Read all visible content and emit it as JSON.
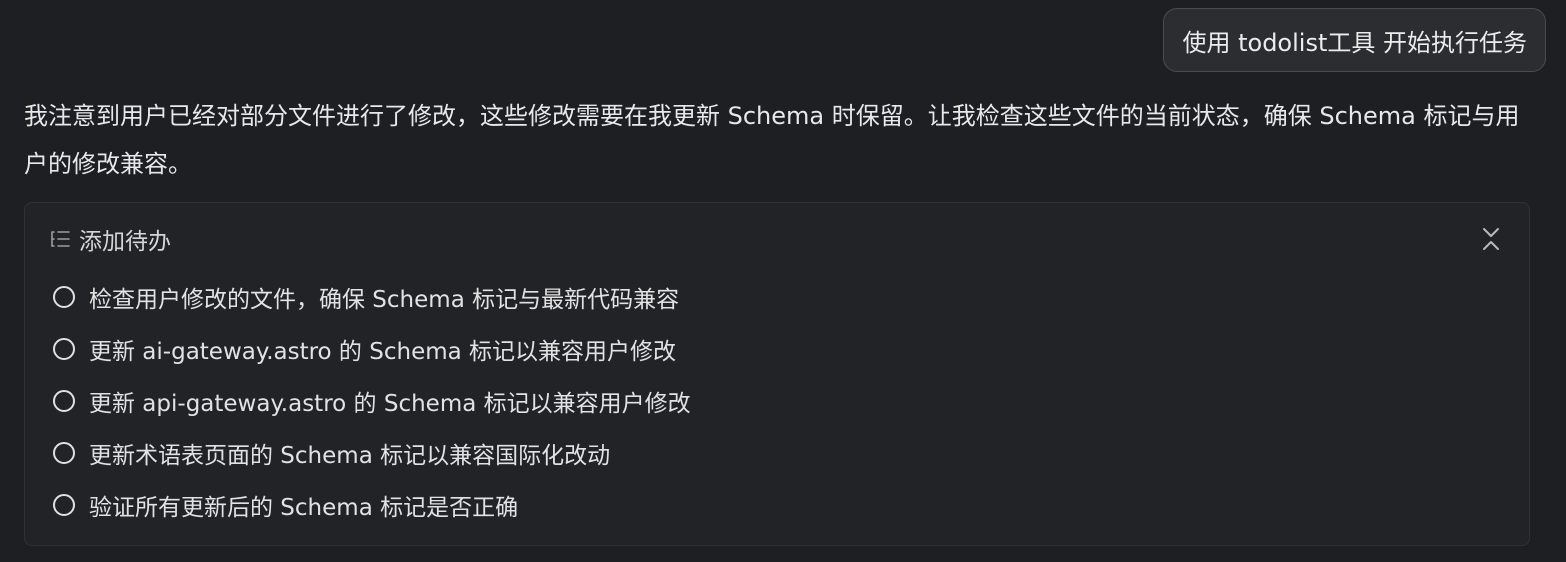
{
  "user_message": "使用 todolist工具 开始执行任务",
  "assistant_message": "我注意到用户已经对部分文件进行了修改，这些修改需要在我更新 Schema 时保留。让我检查这些文件的当前状态，确保 Schema 标记与用户的修改兼容。",
  "todo_card": {
    "title": "添加待办",
    "header_icon": "list-icon",
    "collapse_icon": "collapse-icon",
    "items": [
      {
        "label": "检查用户修改的文件，确保 Schema 标记与最新代码兼容",
        "done": false
      },
      {
        "label": "更新 ai-gateway.astro 的 Schema 标记以兼容用户修改",
        "done": false
      },
      {
        "label": "更新 api-gateway.astro 的 Schema 标记以兼容用户修改",
        "done": false
      },
      {
        "label": "更新术语表页面的 Schema 标记以兼容国际化改动",
        "done": false
      },
      {
        "label": "验证所有更新后的 Schema 标记是否正确",
        "done": false
      }
    ]
  },
  "colors": {
    "background": "#1e1f22",
    "card": "#222327",
    "bubble": "#2b2d31"
  }
}
